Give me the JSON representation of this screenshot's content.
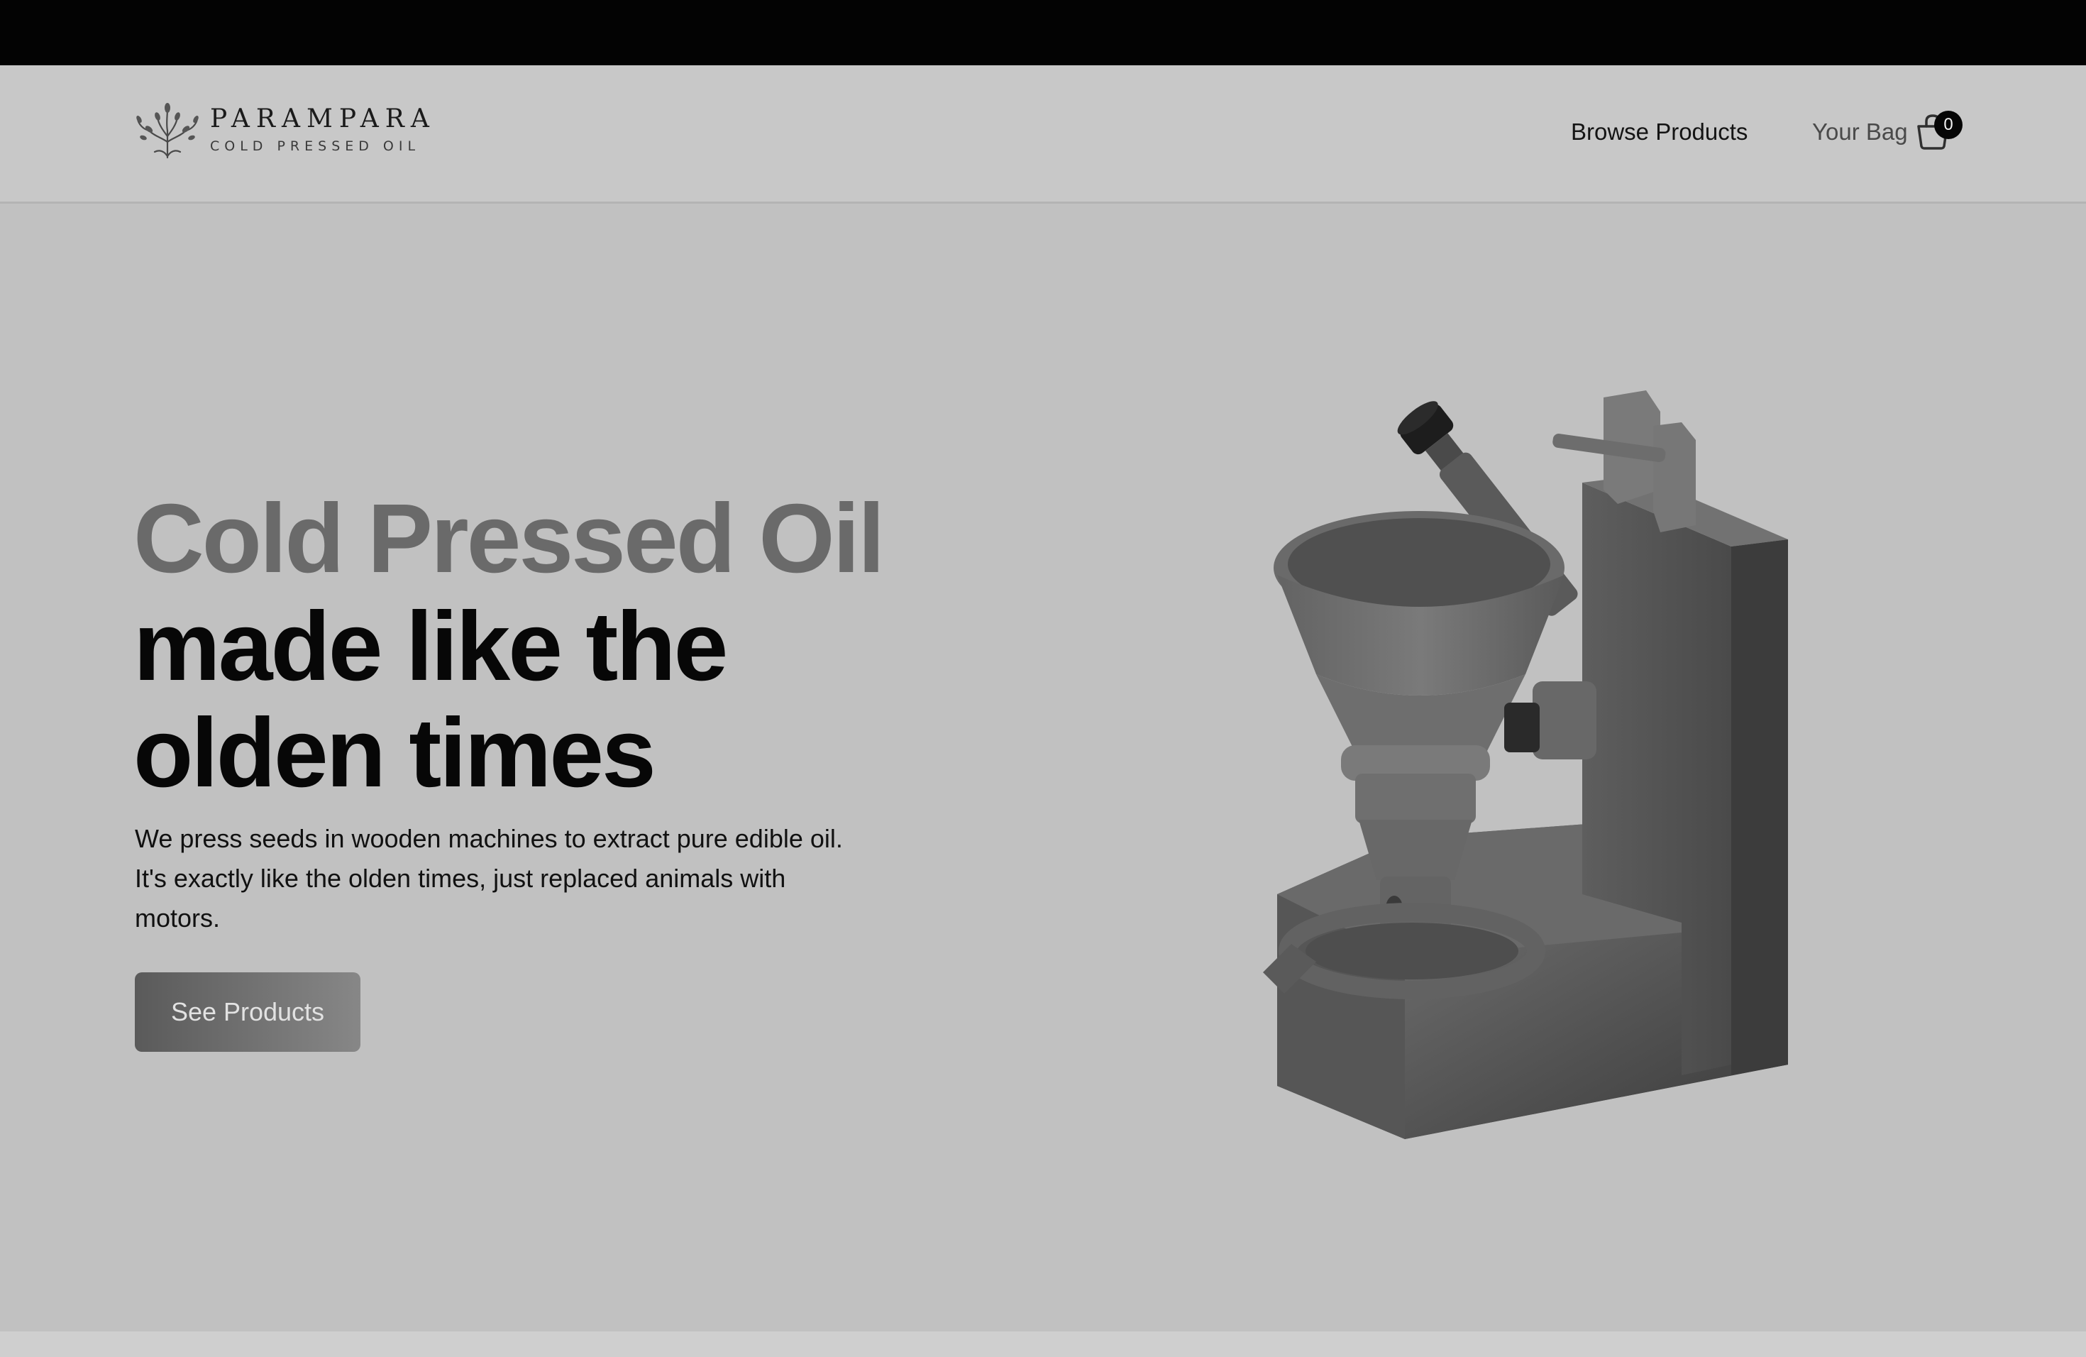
{
  "brand": {
    "name": "PARAMPARA",
    "tagline": "COLD PRESSED OIL",
    "logo_icon": "tree-icon"
  },
  "nav": {
    "browse_label": "Browse Products",
    "bag_label": "Your Bag",
    "bag_count": "0",
    "bag_icon": "shopping-bag-icon"
  },
  "hero": {
    "title_line1": "Cold Pressed Oil",
    "title_line2": "made like the",
    "title_line3": "olden times",
    "description": "We press seeds in wooden machines to extract pure edible oil. It's exactly like the olden times, just replaced animals with motors.",
    "cta_label": "See Products",
    "image_icon": "oil-press-machine-illustration"
  },
  "colors": {
    "background": "#c1c1c1",
    "header": "#c8c8c8",
    "topbar": "#030303",
    "title_muted": "#6a6a6a",
    "title_dark": "#070707"
  }
}
